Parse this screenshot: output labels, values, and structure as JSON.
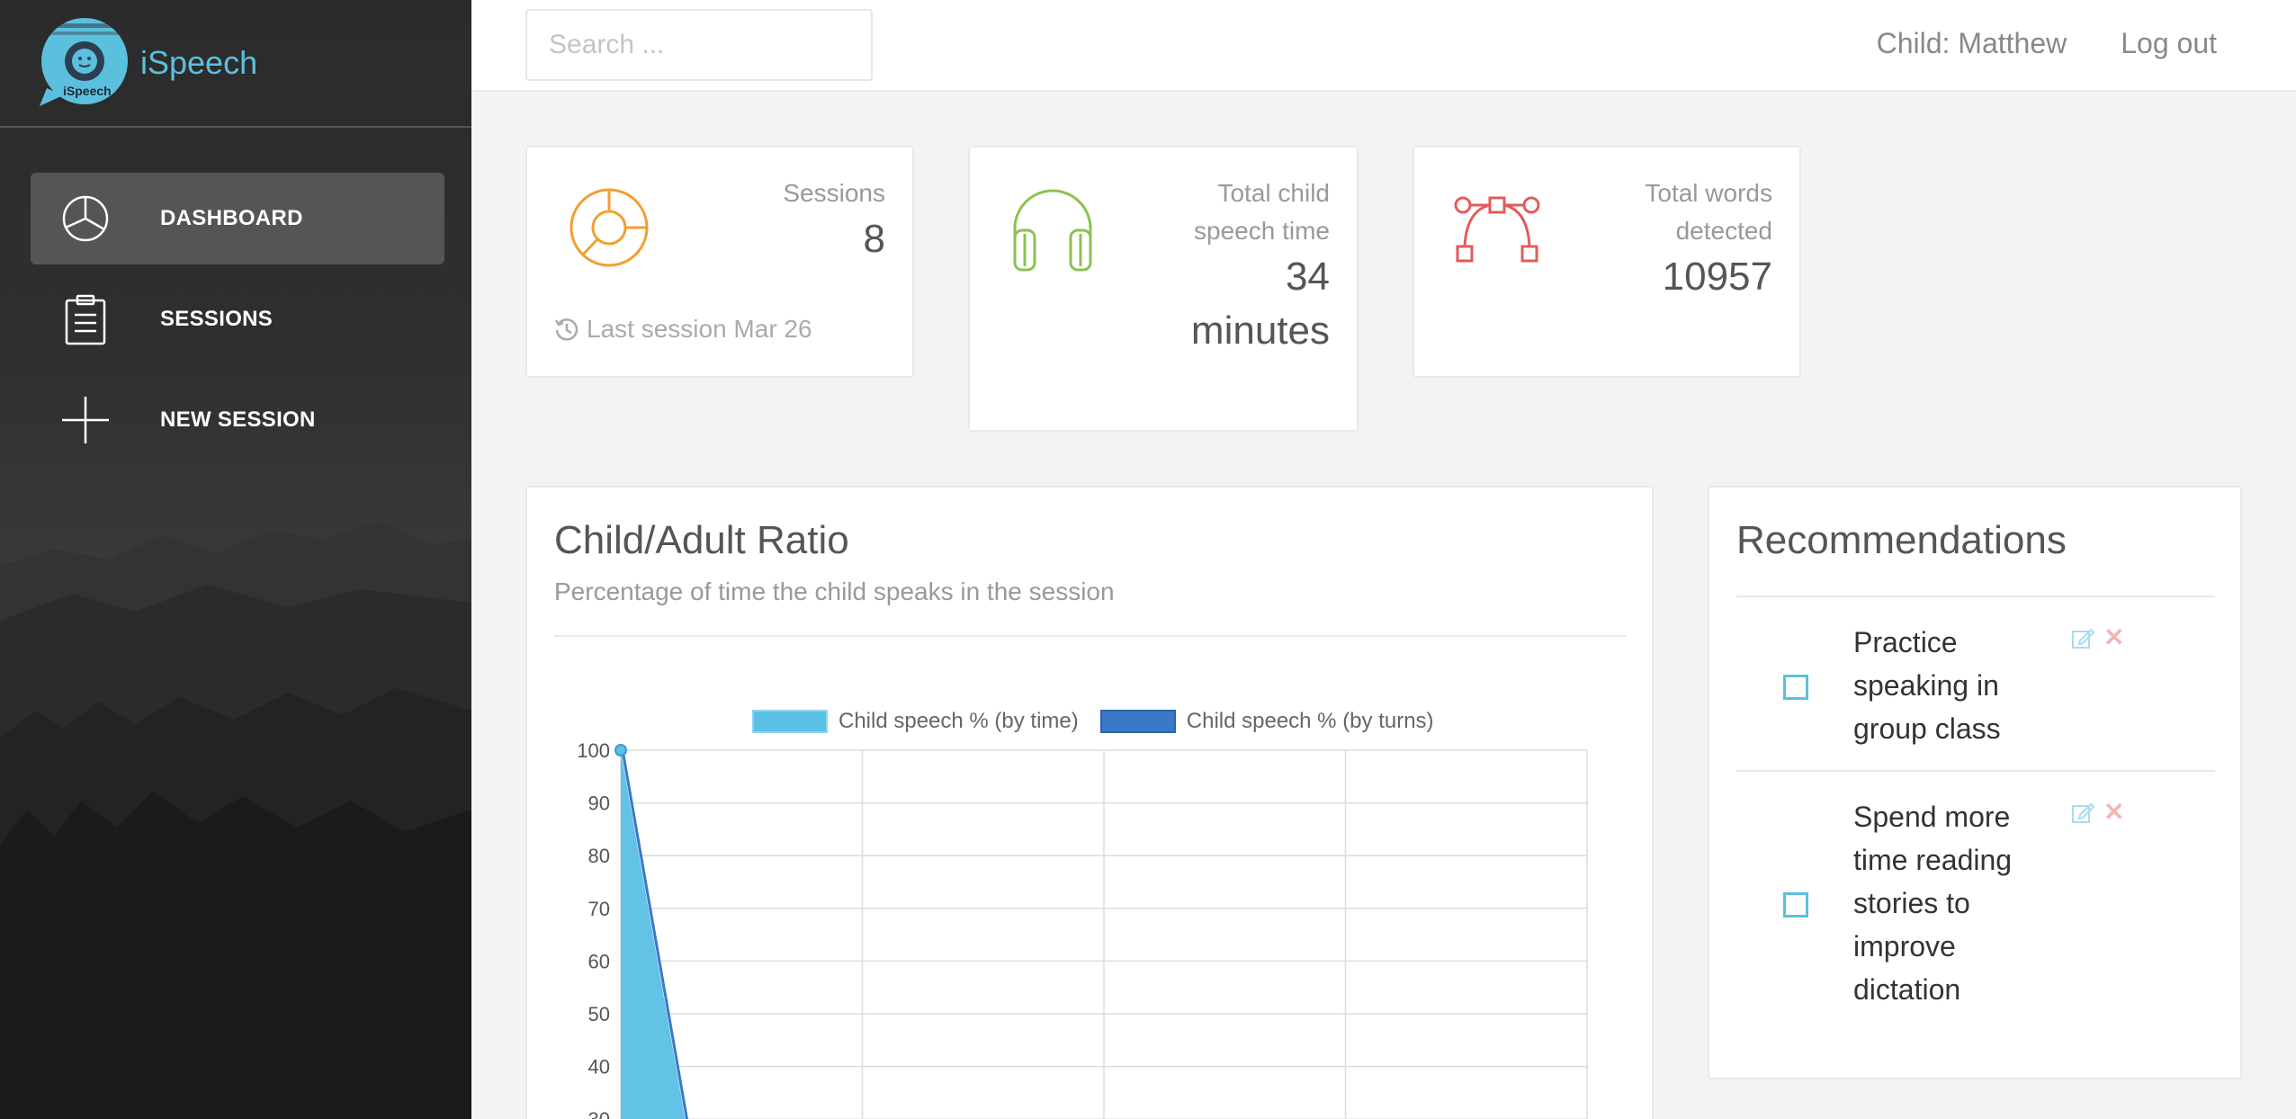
{
  "app": {
    "name": "iSpeech",
    "logo_text": "iSpeech"
  },
  "sidebar": {
    "items": [
      {
        "label": "DASHBOARD",
        "icon": "pie-chart-icon",
        "active": true
      },
      {
        "label": "SESSIONS",
        "icon": "clipboard-icon",
        "active": false
      },
      {
        "label": "NEW SESSION",
        "icon": "plus-icon",
        "active": false
      }
    ]
  },
  "topbar": {
    "search_placeholder": "Search ...",
    "child_label": "Child: Matthew",
    "logout_label": "Log out"
  },
  "stats": {
    "sessions": {
      "label": "Sessions",
      "value": "8",
      "foot": "Last session Mar 26",
      "icon": "target-icon",
      "color": "#f0a030"
    },
    "speech_time": {
      "label_line1": "Total child",
      "label_line2": "speech time",
      "value_line1": "34",
      "value_line2": "minutes",
      "icon": "headphones-icon",
      "color": "#8cc152"
    },
    "words": {
      "label_line1": "Total words",
      "label_line2": "detected",
      "value": "10957",
      "icon": "bezier-curve-icon",
      "color": "#e05c5c"
    }
  },
  "chart_panel": {
    "title": "Child/Adult Ratio",
    "subtitle": "Percentage of time the child speaks in the session"
  },
  "chart_data": {
    "type": "area",
    "series": [
      {
        "name": "Child speech % (by time)",
        "color": "#5bc0e6"
      },
      {
        "name": "Child speech % (by turns)",
        "color": "#3a78c8"
      }
    ],
    "y_ticks": [
      "100",
      "90",
      "80",
      "70",
      "60",
      "50",
      "40",
      "30"
    ],
    "ylim": [
      30,
      100
    ],
    "grid": true,
    "legend_position": "top",
    "visible_points": [
      {
        "series": "Child speech % (by time)",
        "x_index": 0,
        "y": 100
      },
      {
        "series": "Child speech % (by time)",
        "x_index": 0.65,
        "y": 30
      }
    ]
  },
  "recommendations": {
    "title": "Recommendations",
    "items": [
      {
        "lines": [
          "Practice",
          "speaking in",
          "group class"
        ],
        "checked": false
      },
      {
        "lines": [
          "Spend more",
          "time reading",
          "stories to",
          "improve",
          "dictation"
        ],
        "checked": false
      }
    ]
  }
}
